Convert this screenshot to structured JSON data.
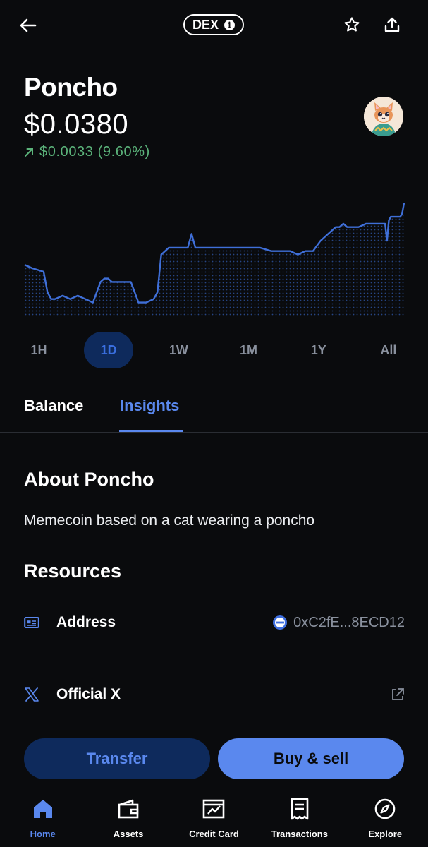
{
  "header": {
    "badge": "DEX"
  },
  "token": {
    "name": "Poncho",
    "price": "$0.0380",
    "change": "$0.0033 (9.60%)",
    "change_color": "#5bb37a"
  },
  "chart_data": {
    "type": "area",
    "title": "",
    "xlabel": "",
    "ylabel": "",
    "line_color": "#3f6fd8",
    "x": [
      0,
      2,
      5,
      6,
      7,
      8,
      10,
      12,
      14,
      16,
      18,
      20,
      21,
      22,
      23,
      25,
      28,
      30,
      32,
      34,
      35,
      36,
      38,
      39,
      40,
      41,
      42,
      43,
      44,
      45,
      46,
      47,
      48,
      50,
      51,
      52,
      54,
      56,
      58,
      60,
      62,
      65,
      67,
      70,
      72,
      74,
      76,
      78,
      80,
      82,
      83,
      84,
      85,
      86,
      88,
      90,
      92,
      94,
      95,
      95.5,
      96,
      96.5,
      97,
      98,
      99,
      99.5,
      100
    ],
    "y": [
      0.0363,
      0.0362,
      0.0361,
      0.0355,
      0.0353,
      0.0353,
      0.0354,
      0.0353,
      0.0354,
      0.0353,
      0.0352,
      0.0358,
      0.0359,
      0.0359,
      0.0358,
      0.0358,
      0.0358,
      0.0352,
      0.0352,
      0.0353,
      0.0355,
      0.0366,
      0.0368,
      0.0368,
      0.0368,
      0.0368,
      0.0368,
      0.0368,
      0.0372,
      0.0368,
      0.0368,
      0.0368,
      0.0368,
      0.0368,
      0.0368,
      0.0368,
      0.0368,
      0.0368,
      0.0368,
      0.0368,
      0.0368,
      0.0367,
      0.0367,
      0.0367,
      0.0366,
      0.0367,
      0.0367,
      0.037,
      0.0372,
      0.0374,
      0.0374,
      0.0375,
      0.0374,
      0.0374,
      0.0374,
      0.0375,
      0.0375,
      0.0375,
      0.0375,
      0.037,
      0.0376,
      0.0377,
      0.0377,
      0.0377,
      0.0377,
      0.0378,
      0.0381
    ],
    "ylim": [
      0.0348,
      0.0383
    ]
  },
  "ranges": {
    "items": [
      "1H",
      "1D",
      "1W",
      "1M",
      "1Y",
      "All"
    ],
    "selected": "1D"
  },
  "tabs": {
    "balance": "Balance",
    "insights": "Insights"
  },
  "about": {
    "title": "About Poncho",
    "text": "Memecoin based on a cat wearing a poncho"
  },
  "resources": {
    "title": "Resources",
    "address_label": "Address",
    "address_value": "0xC2fE...8ECD12",
    "x_label": "Official X"
  },
  "actions": {
    "transfer": "Transfer",
    "buy_sell": "Buy & sell"
  },
  "nav": {
    "home": "Home",
    "assets": "Assets",
    "credit_card": "Credit Card",
    "transactions": "Transactions",
    "explore": "Explore"
  },
  "colors": {
    "accent": "#5a88ee",
    "accent_dark": "#0e2a5c",
    "background": "#0a0b0d"
  }
}
